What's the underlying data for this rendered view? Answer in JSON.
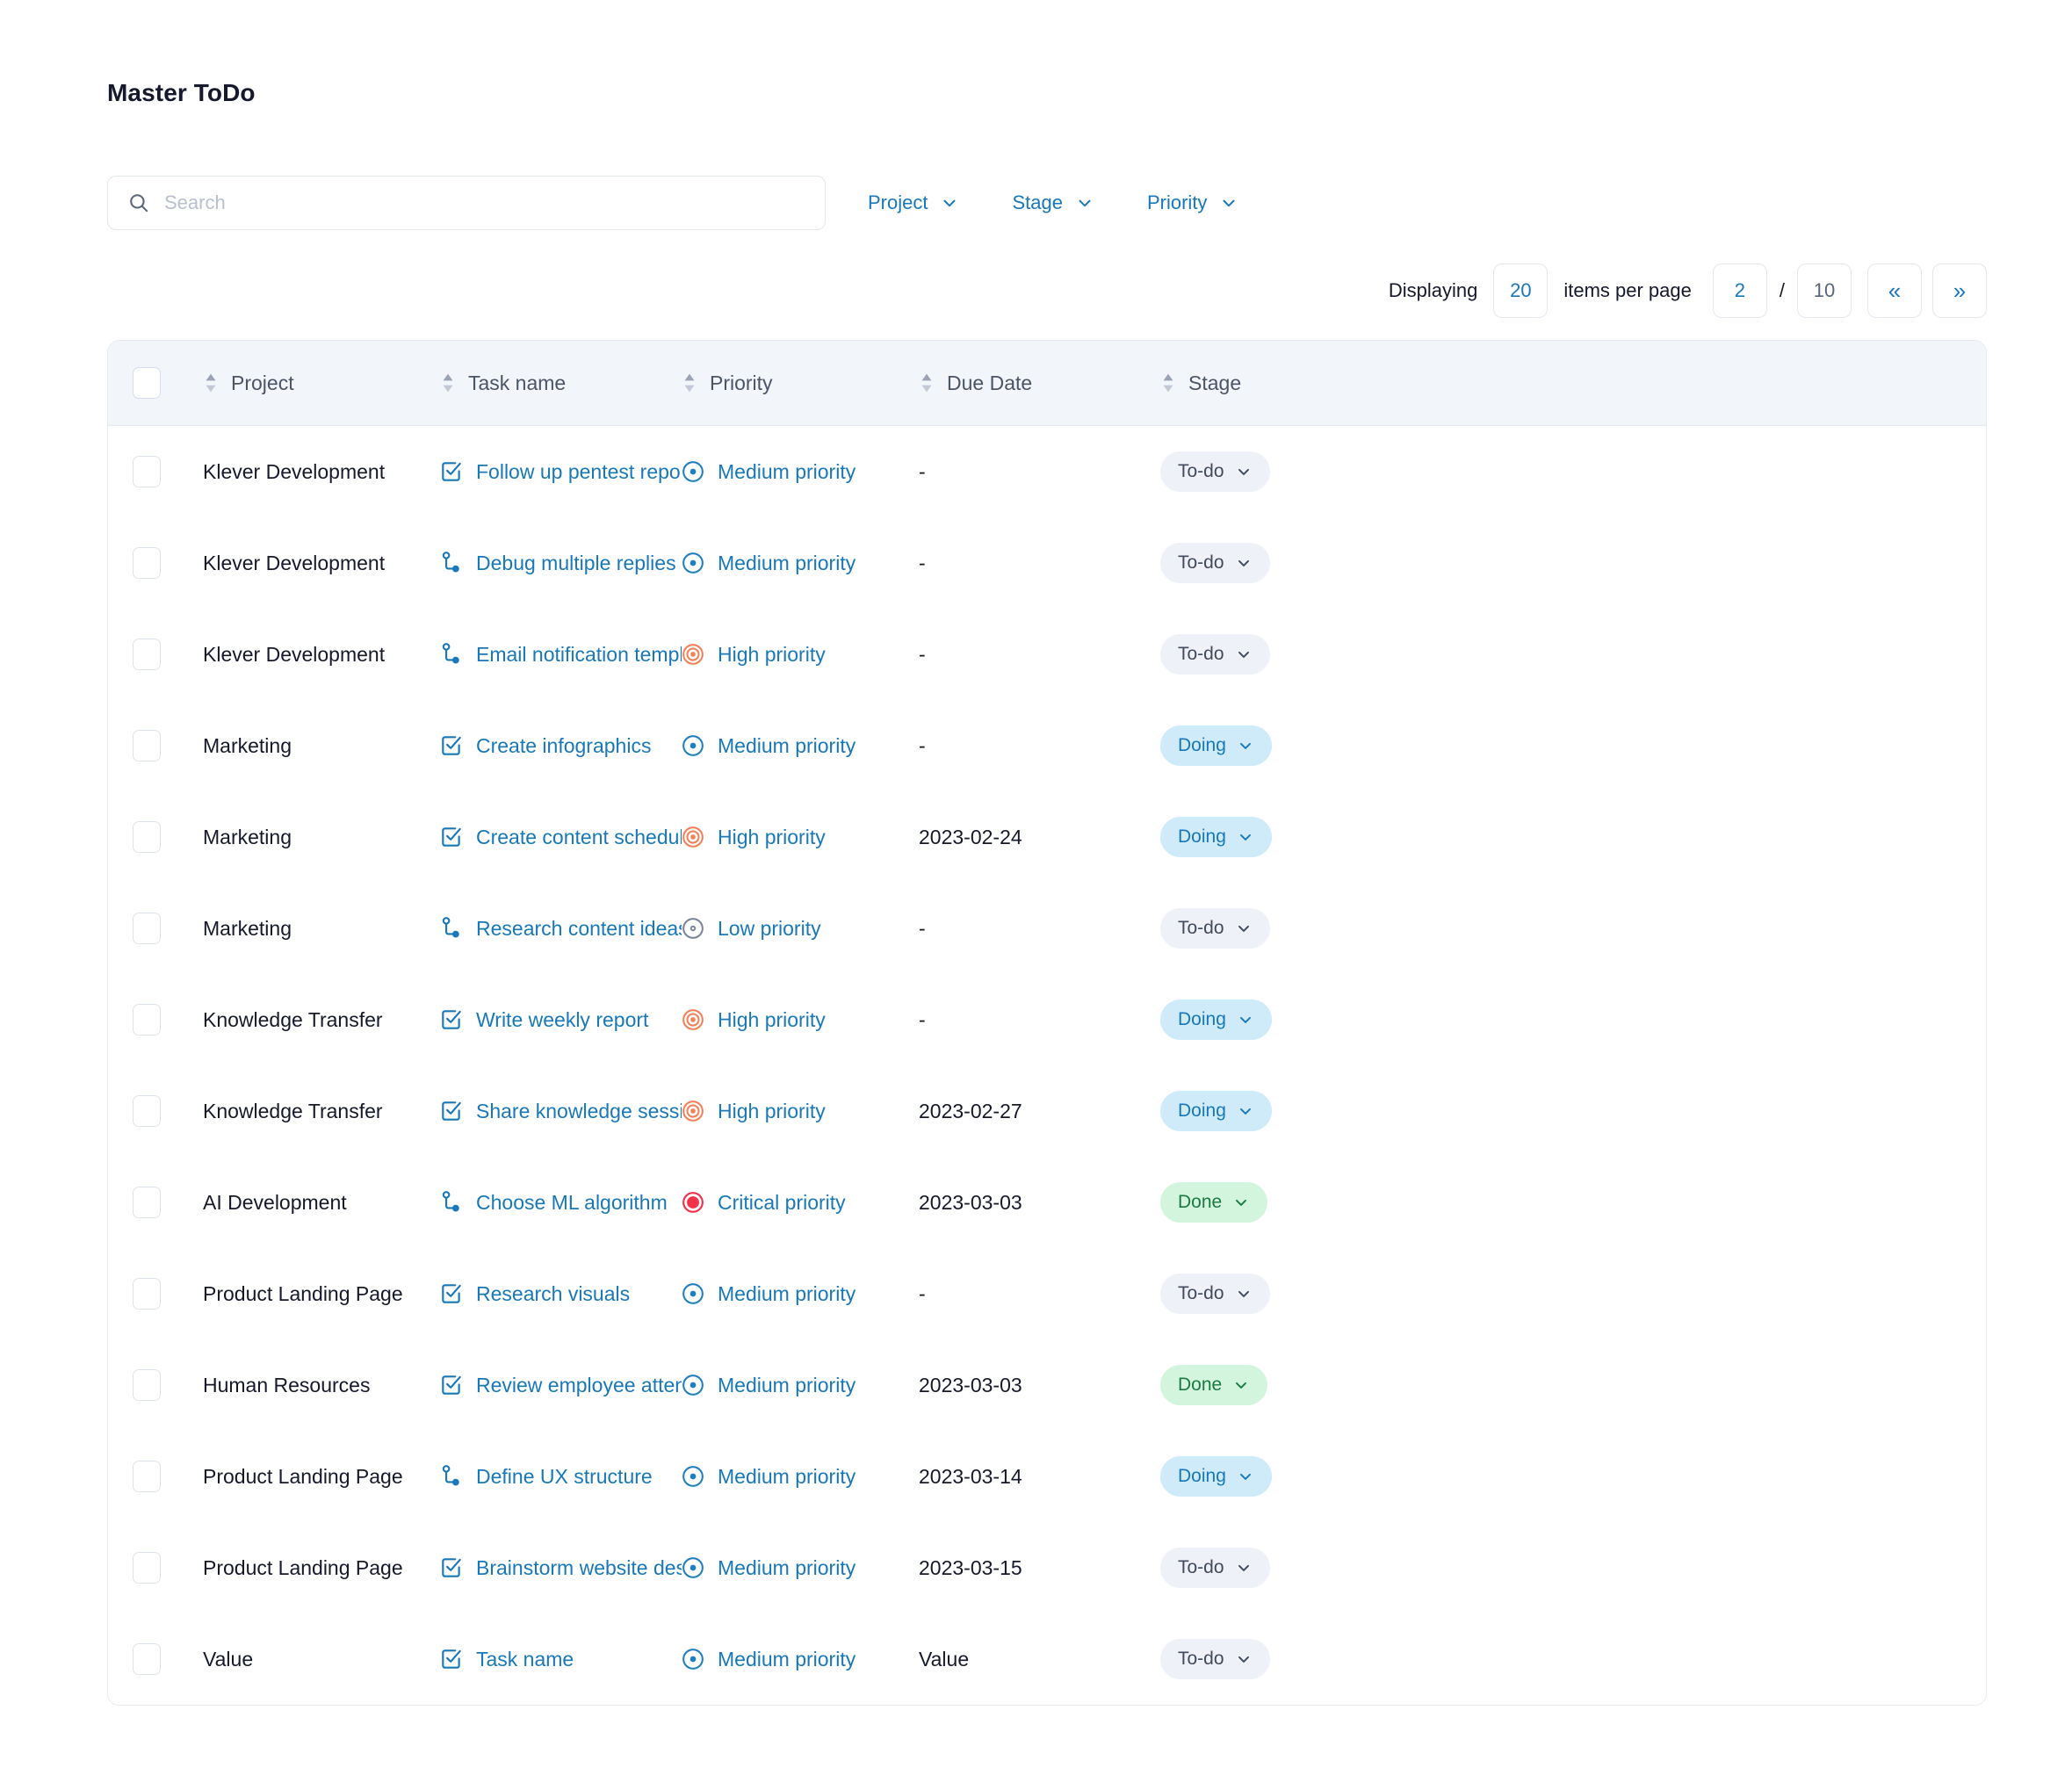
{
  "header": {
    "title": "Master ToDo"
  },
  "search": {
    "placeholder": "Search",
    "value": "",
    "icon": "search-icon"
  },
  "filters": [
    {
      "label": "Project",
      "icon": "chevron-down-icon"
    },
    {
      "label": "Stage",
      "icon": "chevron-down-icon"
    },
    {
      "label": "Priority",
      "icon": "chevron-down-icon"
    }
  ],
  "pagination": {
    "displaying_label": "Displaying",
    "items_per_page": "20",
    "items_per_page_label": "items per page",
    "current_page": "2",
    "separator": "/",
    "total_pages": "10",
    "prev_label": "«",
    "next_label": "»",
    "prev_icon": "double-chevron-left-icon",
    "next_icon": "double-chevron-right-icon"
  },
  "table": {
    "columns": [
      {
        "label": "Project",
        "sortable": true
      },
      {
        "label": "Task name",
        "sortable": true
      },
      {
        "label": "Priority",
        "sortable": true
      },
      {
        "label": "Due Date",
        "sortable": true
      },
      {
        "label": "Stage",
        "sortable": true
      }
    ],
    "rows": [
      {
        "project": "Klever Development",
        "task": "Follow up pentest report",
        "task_icon": "task-check-icon",
        "priority": "Medium priority",
        "priority_level": "medium",
        "due": "-",
        "stage": "To-do"
      },
      {
        "project": "Klever Development",
        "task": "Debug multiple replies tas",
        "task_icon": "subtask-icon",
        "priority": "Medium priority",
        "priority_level": "medium",
        "due": "-",
        "stage": "To-do"
      },
      {
        "project": "Klever Development",
        "task": "Email notification templa..",
        "task_icon": "subtask-icon",
        "priority": "High priority",
        "priority_level": "high",
        "due": "-",
        "stage": "To-do"
      },
      {
        "project": "Marketing",
        "task": "Create infographics",
        "task_icon": "task-check-icon",
        "priority": "Medium priority",
        "priority_level": "medium",
        "due": "-",
        "stage": "Doing"
      },
      {
        "project": "Marketing",
        "task": "Create content schedule",
        "task_icon": "task-check-icon",
        "priority": "High priority",
        "priority_level": "high",
        "due": "2023-02-24",
        "stage": "Doing"
      },
      {
        "project": "Marketing",
        "task": "Research content ideas",
        "task_icon": "subtask-icon",
        "priority": "Low priority",
        "priority_level": "low",
        "due": "-",
        "stage": "To-do"
      },
      {
        "project": "Knowledge Transfer",
        "task": "Write weekly report",
        "task_icon": "task-check-icon",
        "priority": "High priority",
        "priority_level": "high",
        "due": "-",
        "stage": "Doing"
      },
      {
        "project": "Knowledge Transfer",
        "task": "Share knowledge session",
        "task_icon": "task-check-icon",
        "priority": "High priority",
        "priority_level": "high",
        "due": "2023-02-27",
        "stage": "Doing"
      },
      {
        "project": "AI Development",
        "task": "Choose ML algorithm",
        "task_icon": "subtask-icon",
        "priority": "Critical priority",
        "priority_level": "critical",
        "due": "2023-03-03",
        "stage": "Done"
      },
      {
        "project": "Product Landing Page",
        "task": "Research visuals",
        "task_icon": "task-check-icon",
        "priority": "Medium priority",
        "priority_level": "medium",
        "due": "-",
        "stage": "To-do"
      },
      {
        "project": "Human Resources",
        "task": "Review employee attenda",
        "task_icon": "task-check-icon",
        "priority": "Medium priority",
        "priority_level": "medium",
        "due": "2023-03-03",
        "stage": "Done"
      },
      {
        "project": "Product Landing Page",
        "task": "Define UX structure",
        "task_icon": "subtask-icon",
        "priority": "Medium priority",
        "priority_level": "medium",
        "due": "2023-03-14",
        "stage": "Doing"
      },
      {
        "project": "Product Landing Page",
        "task": "Brainstorm website desig",
        "task_icon": "task-check-icon",
        "priority": "Medium priority",
        "priority_level": "medium",
        "due": "2023-03-15",
        "stage": "To-do"
      },
      {
        "project": "Value",
        "task": "Task name",
        "task_icon": "task-check-icon",
        "priority": "Medium priority",
        "priority_level": "medium",
        "due": "Value",
        "stage": "To-do"
      }
    ]
  },
  "colors": {
    "accent_blue": "#1878b9",
    "priority_medium": "#1f7fc0",
    "priority_high": "#f28157",
    "priority_low": "#7a8599",
    "priority_critical": "#f0324b",
    "badge_todo_bg": "#eef1f7",
    "badge_doing_bg": "#cfeaf9",
    "badge_done_bg": "#d3f5dd",
    "header_bg": "#f2f5f9",
    "text_dark": "#16192c"
  }
}
